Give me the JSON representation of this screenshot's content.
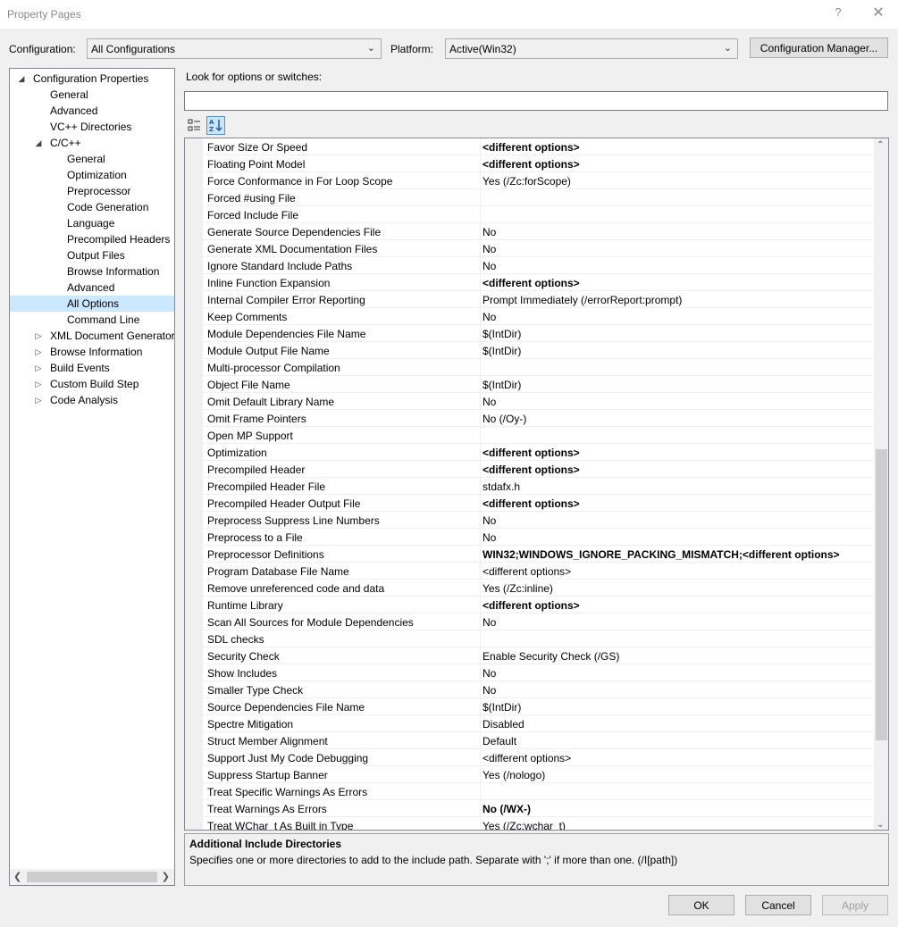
{
  "window": {
    "title": "Property Pages",
    "help_glyph": "?",
    "close_glyph": "✕"
  },
  "config": {
    "label": "Configuration:",
    "value": "All Configurations",
    "platform_label": "Platform:",
    "platform_value": "Active(Win32)",
    "manager_button": "Configuration Manager..."
  },
  "tree": {
    "items": [
      {
        "label": "Configuration Properties",
        "level": 0,
        "expander": "◢"
      },
      {
        "label": "General",
        "level": 1,
        "expander": ""
      },
      {
        "label": "Advanced",
        "level": 1,
        "expander": ""
      },
      {
        "label": "VC++ Directories",
        "level": 1,
        "expander": ""
      },
      {
        "label": "C/C++",
        "level": 1,
        "expander": "◢"
      },
      {
        "label": "General",
        "level": 2,
        "expander": ""
      },
      {
        "label": "Optimization",
        "level": 2,
        "expander": ""
      },
      {
        "label": "Preprocessor",
        "level": 2,
        "expander": ""
      },
      {
        "label": "Code Generation",
        "level": 2,
        "expander": ""
      },
      {
        "label": "Language",
        "level": 2,
        "expander": ""
      },
      {
        "label": "Precompiled Headers",
        "level": 2,
        "expander": ""
      },
      {
        "label": "Output Files",
        "level": 2,
        "expander": ""
      },
      {
        "label": "Browse Information",
        "level": 2,
        "expander": ""
      },
      {
        "label": "Advanced",
        "level": 2,
        "expander": ""
      },
      {
        "label": "All Options",
        "level": 2,
        "expander": "",
        "selected": true
      },
      {
        "label": "Command Line",
        "level": 2,
        "expander": ""
      },
      {
        "label": "XML Document Generator",
        "level": 1,
        "expander": "▷"
      },
      {
        "label": "Browse Information",
        "level": 1,
        "expander": "▷"
      },
      {
        "label": "Build Events",
        "level": 1,
        "expander": "▷"
      },
      {
        "label": "Custom Build Step",
        "level": 1,
        "expander": "▷"
      },
      {
        "label": "Code Analysis",
        "level": 1,
        "expander": "▷"
      }
    ]
  },
  "search": {
    "label": "Look for options or switches:",
    "value": "",
    "placeholder": ""
  },
  "properties": [
    {
      "name": "Favor Size Or Speed",
      "value": "<different options>",
      "bold": true
    },
    {
      "name": "Floating Point Model",
      "value": "<different options>",
      "bold": true
    },
    {
      "name": "Force Conformance in For Loop Scope",
      "value": "Yes (/Zc:forScope)",
      "bold": false
    },
    {
      "name": "Forced #using File",
      "value": "",
      "bold": false
    },
    {
      "name": "Forced Include File",
      "value": "",
      "bold": false
    },
    {
      "name": "Generate Source Dependencies File",
      "value": "No",
      "bold": false
    },
    {
      "name": "Generate XML Documentation Files",
      "value": "No",
      "bold": false
    },
    {
      "name": "Ignore Standard Include Paths",
      "value": "No",
      "bold": false
    },
    {
      "name": "Inline Function Expansion",
      "value": "<different options>",
      "bold": true
    },
    {
      "name": "Internal Compiler Error Reporting",
      "value": "Prompt Immediately (/errorReport:prompt)",
      "bold": false
    },
    {
      "name": "Keep Comments",
      "value": "No",
      "bold": false
    },
    {
      "name": "Module Dependencies File Name",
      "value": "$(IntDir)",
      "bold": false
    },
    {
      "name": "Module Output File Name",
      "value": "$(IntDir)",
      "bold": false
    },
    {
      "name": "Multi-processor Compilation",
      "value": "",
      "bold": false
    },
    {
      "name": "Object File Name",
      "value": "$(IntDir)",
      "bold": false
    },
    {
      "name": "Omit Default Library Name",
      "value": "No",
      "bold": false
    },
    {
      "name": "Omit Frame Pointers",
      "value": "No (/Oy-)",
      "bold": false
    },
    {
      "name": "Open MP Support",
      "value": "",
      "bold": false
    },
    {
      "name": "Optimization",
      "value": "<different options>",
      "bold": true
    },
    {
      "name": "Precompiled Header",
      "value": "<different options>",
      "bold": true
    },
    {
      "name": "Precompiled Header File",
      "value": "stdafx.h",
      "bold": false
    },
    {
      "name": "Precompiled Header Output File",
      "value": "<different options>",
      "bold": true
    },
    {
      "name": "Preprocess Suppress Line Numbers",
      "value": "No",
      "bold": false
    },
    {
      "name": "Preprocess to a File",
      "value": "No",
      "bold": false
    },
    {
      "name": "Preprocessor Definitions",
      "value": "WIN32;WINDOWS_IGNORE_PACKING_MISMATCH;<different options>",
      "bold": true
    },
    {
      "name": "Program Database File Name",
      "value": "<different options>",
      "bold": false
    },
    {
      "name": "Remove unreferenced code and data",
      "value": "Yes (/Zc:inline)",
      "bold": false
    },
    {
      "name": "Runtime Library",
      "value": "<different options>",
      "bold": true
    },
    {
      "name": "Scan All Sources for Module Dependencies",
      "value": "No",
      "bold": false
    },
    {
      "name": "SDL checks",
      "value": "",
      "bold": false
    },
    {
      "name": "Security Check",
      "value": "Enable Security Check (/GS)",
      "bold": false
    },
    {
      "name": "Show Includes",
      "value": "No",
      "bold": false
    },
    {
      "name": "Smaller Type Check",
      "value": "No",
      "bold": false
    },
    {
      "name": "Source Dependencies File Name",
      "value": "$(IntDir)",
      "bold": false
    },
    {
      "name": "Spectre Mitigation",
      "value": "Disabled",
      "bold": false
    },
    {
      "name": "Struct Member Alignment",
      "value": "Default",
      "bold": false
    },
    {
      "name": "Support Just My Code Debugging",
      "value": "<different options>",
      "bold": false
    },
    {
      "name": "Suppress Startup Banner",
      "value": "Yes (/nologo)",
      "bold": false
    },
    {
      "name": "Treat Specific Warnings As Errors",
      "value": "",
      "bold": false
    },
    {
      "name": "Treat Warnings As Errors",
      "value": "No (/WX-)",
      "bold": true
    },
    {
      "name": "Treat WChar_t As Built in Type",
      "value": "Yes (/Zc:wchar_t)",
      "bold": false
    }
  ],
  "description": {
    "title": "Additional Include Directories",
    "text": "Specifies one or more directories to add to the include path. Separate with ';' if more than one.     (/I[path])"
  },
  "buttons": {
    "ok": "OK",
    "cancel": "Cancel",
    "apply": "Apply"
  },
  "colors": {
    "selection": "#cce8ff",
    "active_toggle": "#3399ff"
  }
}
